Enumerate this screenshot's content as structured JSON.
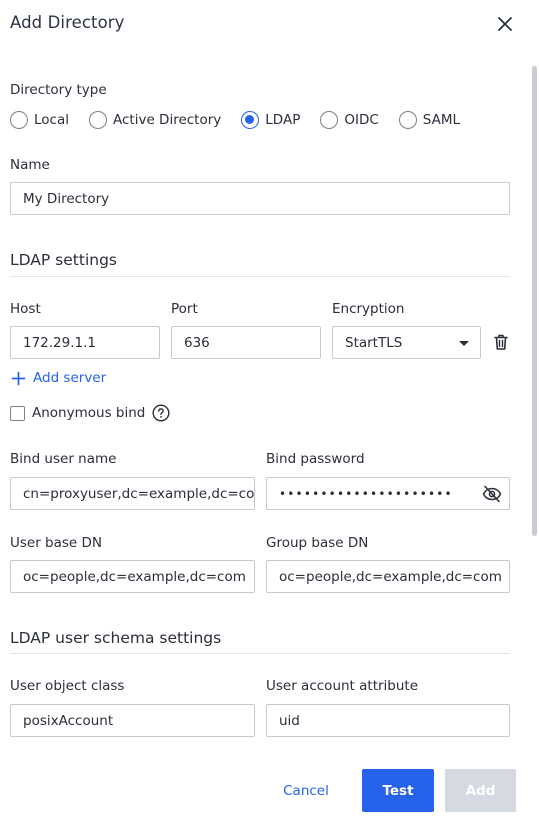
{
  "dialog": {
    "title": "Add Directory",
    "close_icon": "close-icon"
  },
  "directory_type": {
    "label": "Directory type",
    "options": [
      "Local",
      "Active Directory",
      "LDAP",
      "OIDC",
      "SAML"
    ],
    "selected": "LDAP"
  },
  "name": {
    "label": "Name",
    "value": "My Directory"
  },
  "ldap_settings": {
    "title": "LDAP settings",
    "host_label": "Host",
    "host_value": "172.29.1.1",
    "port_label": "Port",
    "port_value": "636",
    "encryption_label": "Encryption",
    "encryption_value": "StartTLS",
    "delete_icon": "trash-icon",
    "add_server_label": "Add server",
    "anonymous_bind_label": "Anonymous bind",
    "anonymous_bind_checked": false,
    "bind_user_label": "Bind user name",
    "bind_user_value": "cn=proxyuser,dc=example,dc=com",
    "bind_password_label": "Bind password",
    "bind_password_value": "•••••••••••••••••••••",
    "user_base_dn_label": "User base DN",
    "user_base_dn_value": "oc=people,dc=example,dc=com",
    "group_base_dn_label": "Group base DN",
    "group_base_dn_value": "oc=people,dc=example,dc=com"
  },
  "schema_settings": {
    "title": "LDAP user schema settings",
    "user_object_class_label": "User object class",
    "user_object_class_value": "posixAccount",
    "user_account_attr_label": "User account attribute",
    "user_account_attr_value": "uid"
  },
  "footer": {
    "cancel_label": "Cancel",
    "test_label": "Test",
    "add_label": "Add"
  },
  "colors": {
    "accent": "#2563eb",
    "disabled": "#d4d9e2",
    "border": "#c6c9cf"
  }
}
